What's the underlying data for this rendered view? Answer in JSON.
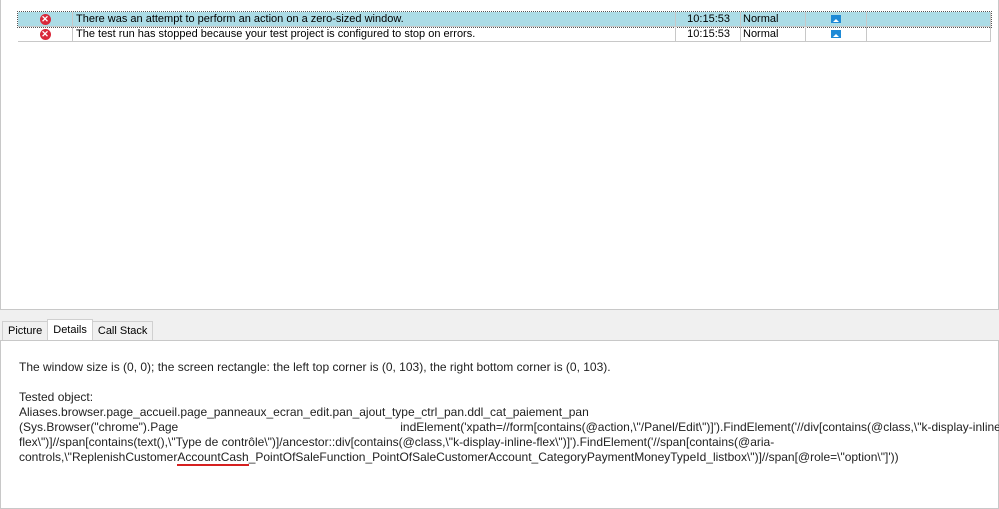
{
  "log_rows": [
    {
      "icon": "error-icon",
      "message": "There was an attempt to perform an action on a zero-sized window.",
      "time": "10:15:53",
      "priority": "Normal",
      "picture": "picture-icon",
      "selected": true
    },
    {
      "icon": "error-icon",
      "message": "The test run has stopped because your test project is configured to stop on errors.",
      "time": "10:15:53",
      "priority": "Normal",
      "picture": "picture-icon",
      "selected": false
    }
  ],
  "tabs": [
    {
      "label": "Picture"
    },
    {
      "label": "Details"
    },
    {
      "label": "Call Stack"
    }
  ],
  "details": {
    "line1": "The window size is (0, 0); the screen rectangle: the left top corner is (0, 103), the right bottom corner is (0, 103).",
    "tested_label": "Tested object:",
    "alias": "Aliases.browser.page_accueil.page_panneaux_ecran_edit.pan_ajout_type_ctrl_pan.ddl_cat_paiement_pan",
    "path_a": "(Sys.Browser(\"chrome\").Page",
    "path_b": "indElement('xpath=//form[contains(@action,\\\"/Panel/Edit\\\")]').FindElement('//div[contains(@class,\\\"k-display-inline-",
    "path_c": "flex\\\")]//span[contains(text(),\\\"Type de contrôle\\\")]/ancestor::div[contains(@class,\\\"k-display-inline-flex\\\")]').FindElement('//span[contains(@aria-",
    "path_d1": "controls,\\\"ReplenishCustomer",
    "path_d2": "AccountCash",
    "path_d3": "_PointOfSaleFunction_PointOfSaleCustomerAccount_CategoryPaymentMoneyTypeId_listbox\\\")]//span[@role=\\\"option\\\"]'))"
  }
}
